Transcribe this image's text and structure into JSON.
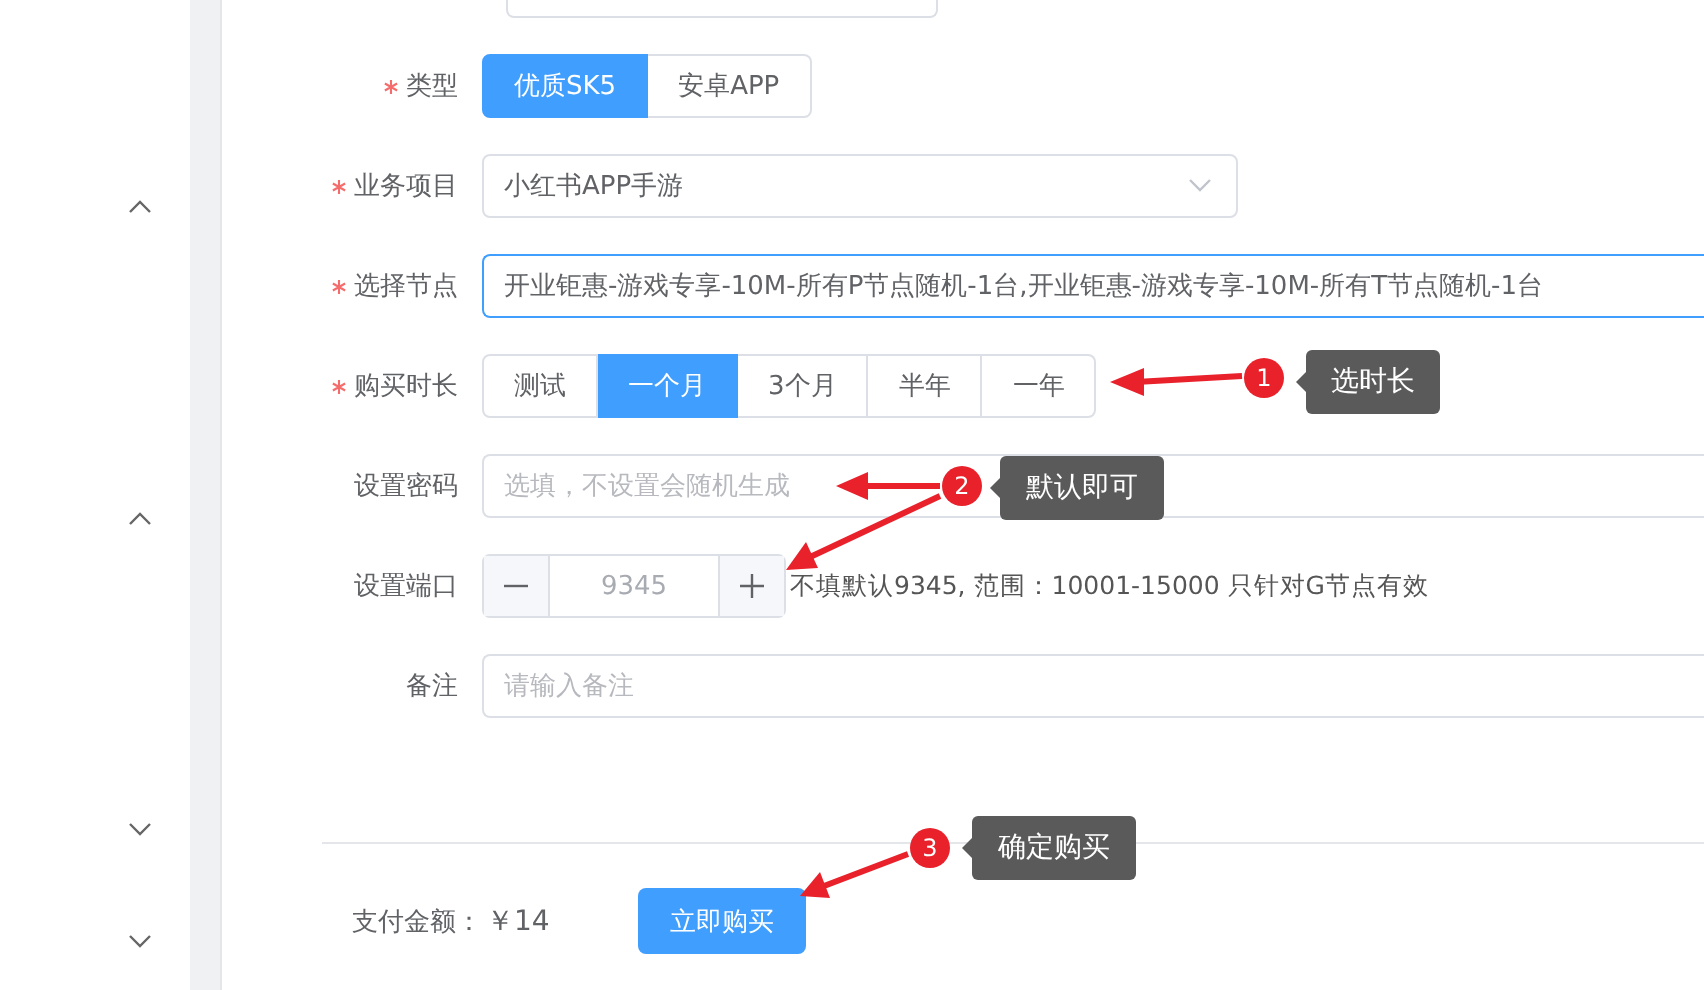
{
  "sidebar": {
    "carets": [
      {
        "expanded": true
      },
      {
        "expanded": true
      },
      {
        "expanded": false
      },
      {
        "expanded": false
      }
    ]
  },
  "form": {
    "fields": [
      {
        "label": "类型",
        "required": true,
        "kind": "segmented",
        "options": [
          {
            "label": "优质SK5",
            "selected": true
          },
          {
            "label": "安卓APP",
            "selected": false
          }
        ]
      },
      {
        "label": "业务项目",
        "required": true,
        "kind": "select",
        "value": "小红书APP手游"
      },
      {
        "label": "选择节点",
        "required": true,
        "kind": "text",
        "focused": true,
        "value": "开业钜惠-游戏专享-10M-所有P节点随机-1台,开业钜惠-游戏专享-10M-所有T节点随机-1台"
      },
      {
        "label": "购买时长",
        "required": true,
        "kind": "segmented",
        "options": [
          {
            "label": "测试",
            "selected": false
          },
          {
            "label": "一个月",
            "selected": true
          },
          {
            "label": "3个月",
            "selected": false
          },
          {
            "label": "半年",
            "selected": false
          },
          {
            "label": "一年",
            "selected": false
          }
        ]
      },
      {
        "label": "设置密码",
        "required": false,
        "kind": "text",
        "focused": false,
        "placeholder": "选填，不设置会随机生成"
      },
      {
        "label": "设置端口",
        "required": false,
        "kind": "number",
        "placeholder": "9345",
        "hint": "不填默认9345, 范围：10001-15000 只针对G节点有效"
      },
      {
        "label": "备注",
        "required": false,
        "kind": "text",
        "focused": false,
        "placeholder": "请输入备注"
      }
    ]
  },
  "footer": {
    "amount_label": "支付金额：",
    "amount": "￥14",
    "button": "立即购买"
  },
  "annotations": [
    {
      "number": "1",
      "text": "选时长"
    },
    {
      "number": "2",
      "text": "默认即可"
    },
    {
      "number": "3",
      "text": "确定购买"
    }
  ]
}
